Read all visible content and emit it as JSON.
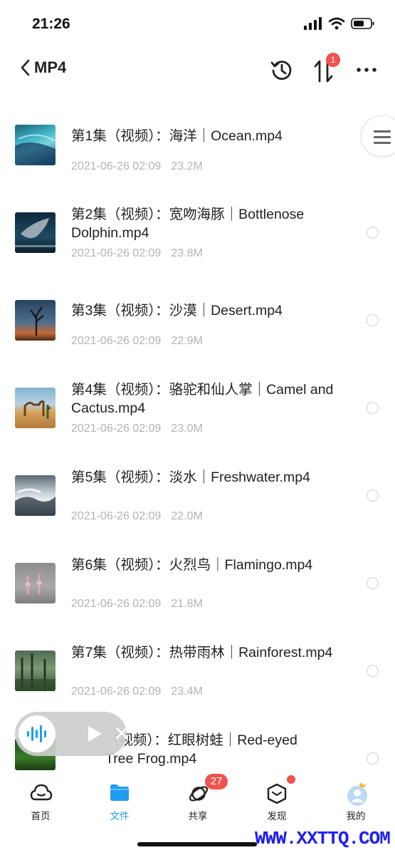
{
  "status_bar": {
    "time": "21:26"
  },
  "header": {
    "title": "MP4",
    "badge_count": "1",
    "icons": [
      "back-chevron-icon",
      "history-icon",
      "sort-icon",
      "more-icon"
    ]
  },
  "files": [
    {
      "name": "第1集（视频）：海洋｜Ocean.mp4",
      "date": "2021-06-26 02:09",
      "size": "23.2M"
    },
    {
      "name": "第2集（视频）：宽吻海豚｜Bottlenose Dolphin.mp4",
      "date": "2021-06-26 02:09",
      "size": "23.8M"
    },
    {
      "name": "第3集（视频）：沙漠｜Desert.mp4",
      "date": "2021-06-26 02:09",
      "size": "22.9M"
    },
    {
      "name": "第4集（视频）：骆驼和仙人掌｜Camel and Cactus.mp4",
      "date": "2021-06-26 02:09",
      "size": "23.0M"
    },
    {
      "name": "第5集（视频）：淡水｜Freshwater.mp4",
      "date": "2021-06-26 02:09",
      "size": "22.0M"
    },
    {
      "name": "第6集（视频）：火烈鸟｜Flamingo.mp4",
      "date": "2021-06-26 02:09",
      "size": "21.8M"
    },
    {
      "name": "第7集（视频）：热带雨林｜Rainforest.mp4",
      "date": "2021-06-26 02:09",
      "size": "23.4M"
    },
    {
      "name": "（视频）：红眼树蛙｜Red-eyed Tree Frog.mp4",
      "date": "",
      "size": ""
    }
  ],
  "tabs": [
    {
      "label": "首页",
      "icon": "cloud-icon",
      "active": false
    },
    {
      "label": "文件",
      "icon": "folder-icon",
      "active": true
    },
    {
      "label": "共享",
      "icon": "orbit-icon",
      "active": false,
      "badge": "27"
    },
    {
      "label": "发现",
      "icon": "box-icon",
      "active": false,
      "dot": true
    },
    {
      "label": "我的",
      "icon": "avatar-icon",
      "active": false
    }
  ],
  "watermark": "WWW.XXTTQ.COM",
  "colors": {
    "accent": "#1f9cf0",
    "badge": "#f0524f",
    "meta": "#b3b3b3"
  }
}
